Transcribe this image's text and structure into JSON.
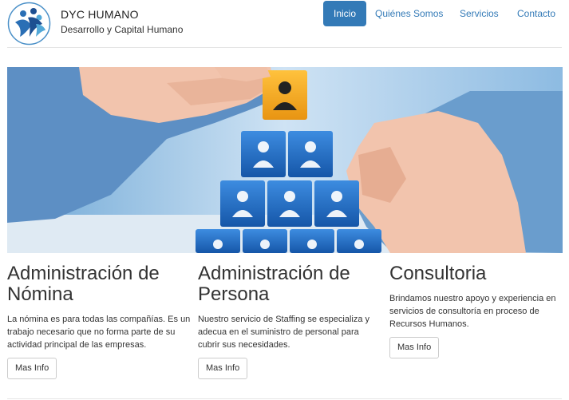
{
  "brand": {
    "title": "DYC HUMANO",
    "subtitle": "Desarrollo y Capital Humano",
    "logo_icon": "people-logo-icon"
  },
  "nav": {
    "items": [
      {
        "label": "Inicio",
        "active": true
      },
      {
        "label": "Quiénes Somos",
        "active": false
      },
      {
        "label": "Servicios",
        "active": false
      },
      {
        "label": "Contacto",
        "active": false
      }
    ]
  },
  "colors": {
    "primary": "#337ab7",
    "hero_blue": "#1f6fc4",
    "highlight": "#f5a623"
  },
  "hero": {
    "icon": "org-pyramid-hero-image"
  },
  "columns": [
    {
      "title": "Administración de Nómina",
      "text": "La nómina es para todas las compañías. Es un trabajo necesario que no forma parte de su actividad principal de las empresas.",
      "button": "Mas Info"
    },
    {
      "title": "Administración de Persona",
      "text": "Nuestro servicio de Staffing se especializa y adecua en el suministro de personal para cubrir sus necesidades.",
      "button": "Mas Info"
    },
    {
      "title": "Consultoria",
      "text": "Brindamos nuestro apoyo y experiencia en servicios de consultoría en proceso de Recursos Humanos.",
      "button": "Mas Info"
    }
  ]
}
